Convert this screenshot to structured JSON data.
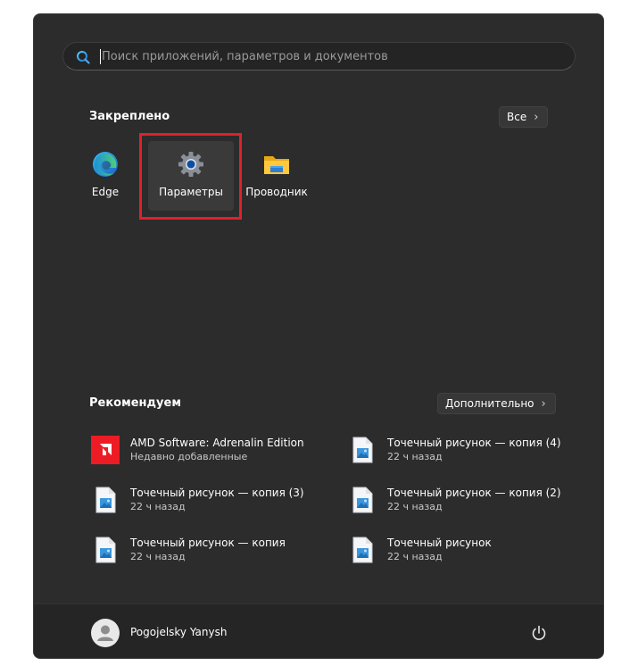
{
  "search": {
    "placeholder": "Поиск приложений, параметров и документов"
  },
  "pinned": {
    "title": "Закреплено",
    "all_label": "Все",
    "apps": [
      {
        "label": "Edge",
        "icon": "edge-icon"
      },
      {
        "label": "Параметры",
        "icon": "gear-icon"
      },
      {
        "label": "Проводник",
        "icon": "folder-icon"
      }
    ]
  },
  "recommended": {
    "title": "Рекомендуем",
    "more_label": "Дополнительно",
    "items": [
      {
        "name": "AMD Software: Adrenalin Edition",
        "sub": "Недавно добавленные",
        "icon": "amd-icon"
      },
      {
        "name": "Точечный рисунок — копия (4)",
        "sub": "22 ч назад",
        "icon": "image-file-icon"
      },
      {
        "name": "Точечный рисунок — копия (3)",
        "sub": "22 ч назад",
        "icon": "image-file-icon"
      },
      {
        "name": "Точечный рисунок — копия (2)",
        "sub": "22 ч назад",
        "icon": "image-file-icon"
      },
      {
        "name": "Точечный рисунок — копия",
        "sub": "22 ч назад",
        "icon": "image-file-icon"
      },
      {
        "name": "Точечный рисунок",
        "sub": "22 ч назад",
        "icon": "image-file-icon"
      }
    ]
  },
  "user": {
    "name": "Pogojelsky Yanysh"
  },
  "colors": {
    "menu_bg": "#2c2c2c",
    "footer_bg": "#252525",
    "accent": "#0067c0",
    "highlight": "#e0202a",
    "amd_red": "#ed1c24"
  }
}
